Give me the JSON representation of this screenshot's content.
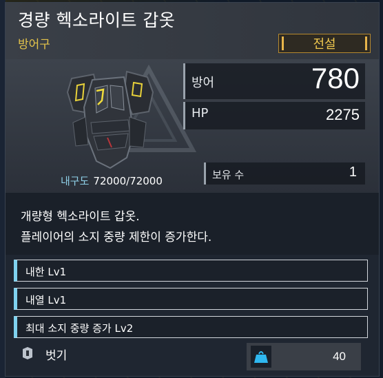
{
  "item": {
    "name": "경량 헥소라이트 갑옷",
    "category": "방어구",
    "grade": "전설"
  },
  "stats": {
    "defense_label": "방어",
    "defense_value": "780",
    "hp_label": "HP",
    "hp_value": "2275",
    "owned_label": "보유 수",
    "owned_value": "1",
    "durability_label": "내구도",
    "durability_value": "72000/72000"
  },
  "description": {
    "line1": "개량형 헥소라이트 갑옷.",
    "line2": "플레이어의 소지 중량 제한이 증가한다."
  },
  "traits": [
    {
      "label": "내한 Lv1"
    },
    {
      "label": "내열 Lv1"
    },
    {
      "label": "최대 소지 중량 증가 Lv2"
    }
  ],
  "footer": {
    "unequip_label": "벗기",
    "weight_value": "40"
  },
  "icons": {
    "unequip": "unequip-icon",
    "weight": "weight-icon",
    "armor": "armor-icon"
  },
  "colors": {
    "grade": "#f1c94e",
    "category": "#e2c24a",
    "trait_accent": "#7fd2ef",
    "weight_icon": "#2fb8f0"
  }
}
